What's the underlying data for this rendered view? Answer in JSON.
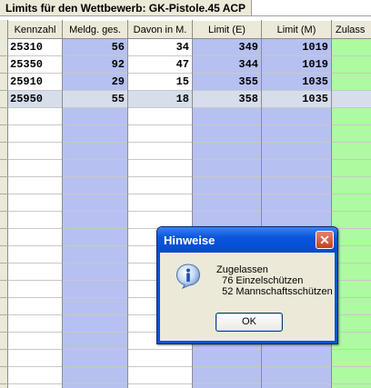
{
  "window": {
    "title": "Limits für den Wettbewerb: GK-Pistole.45 ACP"
  },
  "table": {
    "columns": [
      {
        "label": "Kennzahl"
      },
      {
        "label": "Meldg. ges."
      },
      {
        "label": "Davon in M."
      },
      {
        "label": "Limit (E)"
      },
      {
        "label": "Limit (M)"
      },
      {
        "label": "Zulass"
      }
    ],
    "rows": [
      {
        "kennzahl": "25310",
        "meldg": "56",
        "davon": "34",
        "limit_e": "349",
        "limit_m": "1019"
      },
      {
        "kennzahl": "25350",
        "meldg": "92",
        "davon": "47",
        "limit_e": "344",
        "limit_m": "1019"
      },
      {
        "kennzahl": "25910",
        "meldg": "29",
        "davon": "15",
        "limit_e": "355",
        "limit_m": "1035"
      },
      {
        "kennzahl": "25950",
        "meldg": "55",
        "davon": "18",
        "limit_e": "358",
        "limit_m": "1035"
      }
    ],
    "selected_row_index": 3
  },
  "dialog": {
    "title": "Hinweise",
    "icon": "info-icon",
    "message": "Zugelassen\n  76 Einzelschützen\n  52 Mannschaftsschützen",
    "ok_label": "OK",
    "close_icon": "close-icon"
  },
  "colors": {
    "column_blue": "#b6c1f1",
    "column_green": "#adfaa0",
    "dialog_title": "#0a55dc",
    "selection": "#d6deec"
  }
}
